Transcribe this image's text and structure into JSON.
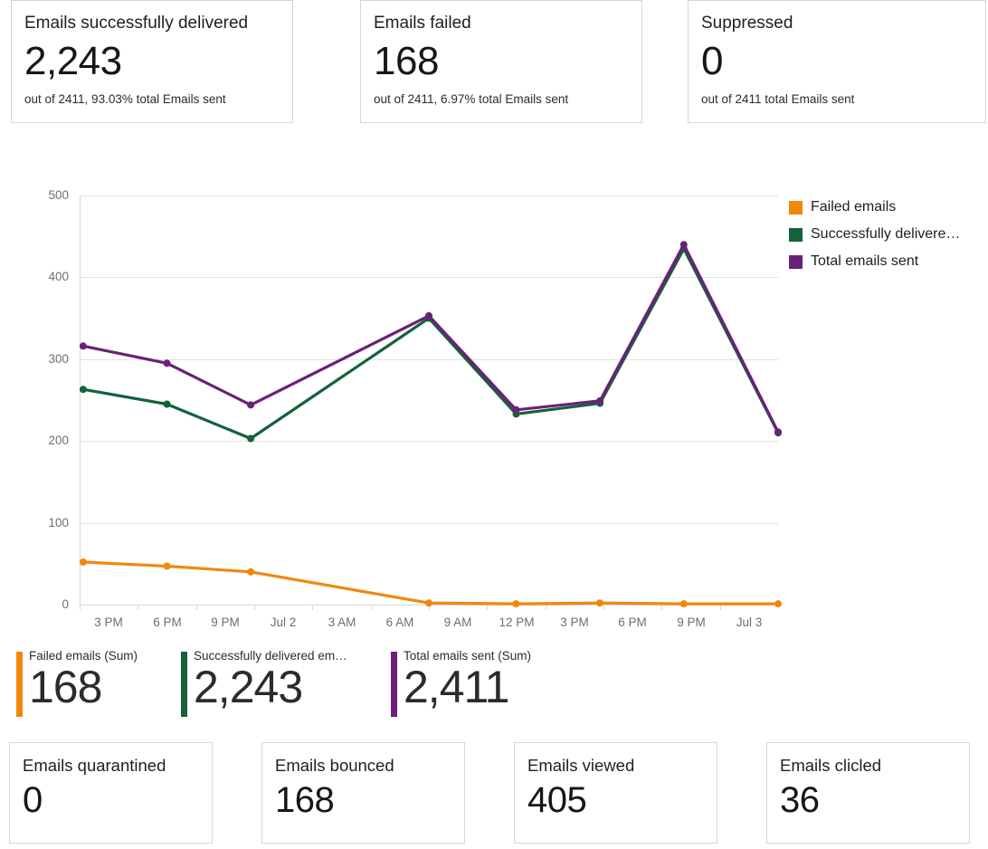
{
  "top_cards": [
    {
      "title": "Emails successfully delivered",
      "value": "2,243",
      "subtitle": "out of 2411, 93.03% total Emails sent"
    },
    {
      "title": "Emails failed",
      "value": "168",
      "subtitle": "out of 2411, 6.97% total Emails sent"
    },
    {
      "title": "Suppressed",
      "value": "0",
      "subtitle": "out of 2411 total Emails sent"
    }
  ],
  "bottom_cards": [
    {
      "title": "Emails quarantined",
      "value": "0"
    },
    {
      "title": "Emails bounced",
      "value": "168"
    },
    {
      "title": "Emails viewed",
      "value": "405"
    },
    {
      "title": "Emails clicled",
      "value": "36"
    }
  ],
  "legend": [
    {
      "label": "Failed emails",
      "color": "#F2870D"
    },
    {
      "label": "Successfully delivere…",
      "color": "#14613A"
    },
    {
      "label": "Total emails sent",
      "color": "#6B2079"
    }
  ],
  "summary": [
    {
      "label": "Failed emails (Sum)",
      "value": "168",
      "color": "#F2870D"
    },
    {
      "label": "Successfully delivered em…",
      "value": "2,243",
      "color": "#14613A"
    },
    {
      "label": "Total emails sent (Sum)",
      "value": "2,411",
      "color": "#6B2079"
    }
  ],
  "chart_data": {
    "type": "line",
    "title": "",
    "xlabel": "",
    "ylabel": "",
    "ylim": [
      0,
      500
    ],
    "yticks": [
      0,
      100,
      200,
      300,
      400,
      500
    ],
    "grid": true,
    "legend_position": "right",
    "x": [
      "3 PM",
      "6 PM",
      "9 PM",
      "Jul 2",
      "3 AM",
      "6 AM",
      "9 AM",
      "12 PM",
      "3 PM",
      "6 PM",
      "9 PM",
      "Jul 3"
    ],
    "xticks": [
      "3 PM",
      "6 PM",
      "9 PM",
      "Jul 2",
      "3 AM",
      "6 AM",
      "9 AM",
      "12 PM",
      "3 PM",
      "6 PM",
      "9 PM",
      "Jul 3"
    ],
    "series": [
      {
        "name": "Failed emails",
        "color": "#F2870D",
        "values": [
          52,
          47,
          40,
          2,
          1,
          2,
          1,
          1
        ]
      },
      {
        "name": "Successfully delivered emails",
        "color": "#14613A",
        "values": [
          263,
          245,
          203,
          350,
          233,
          246,
          435,
          210
        ]
      },
      {
        "name": "Total emails sent",
        "color": "#6B2079",
        "values": [
          316,
          295,
          244,
          353,
          238,
          249,
          440,
          211
        ]
      }
    ],
    "point_x_labels": [
      "3 PM",
      "6 PM",
      "9 PM",
      "6 AM",
      "9 AM",
      "12 PM",
      "9 PM",
      "Jul 3"
    ]
  }
}
